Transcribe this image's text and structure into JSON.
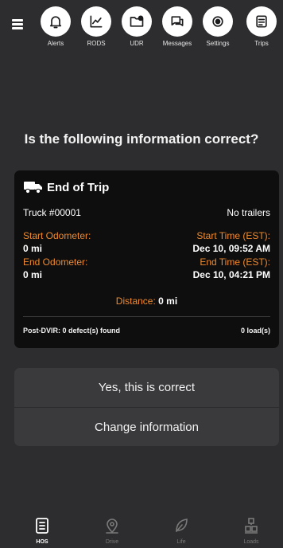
{
  "nav": {
    "items": [
      {
        "label": "Alerts",
        "icon": "bell-icon"
      },
      {
        "label": "RODS",
        "icon": "chart-icon"
      },
      {
        "label": "UDR",
        "icon": "folder-icon"
      },
      {
        "label": "Messages",
        "icon": "chat-icon"
      },
      {
        "label": "Settings",
        "icon": "gear-icon"
      },
      {
        "label": "Trips",
        "icon": "list-icon"
      }
    ]
  },
  "question": "Is the following information correct?",
  "card": {
    "title": "End of Trip",
    "truck": "Truck #00001",
    "trailers": "No trailers",
    "start_odometer_label": "Start Odometer:",
    "start_odometer_value": "0 mi",
    "start_time_label": "Start Time (EST):",
    "start_time_value": "Dec 10, 09:52 AM",
    "end_odometer_label": "End Odometer:",
    "end_odometer_value": "0 mi",
    "end_time_label": "End Time (EST):",
    "end_time_value": "Dec 10, 04:21 PM",
    "distance_label": "Distance:",
    "distance_value": "0 mi",
    "post_dvir": "Post-DVIR: 0  defect(s) found",
    "loads": "0 load(s)"
  },
  "actions": {
    "confirm": "Yes, this is correct",
    "change": "Change information"
  },
  "tabs": [
    {
      "label": "HOS",
      "active": true
    },
    {
      "label": "Drive",
      "active": false
    },
    {
      "label": "Life",
      "active": false
    },
    {
      "label": "Loads",
      "active": false
    }
  ],
  "colors": {
    "background": "#2d2d2f",
    "card": "#0e0e0e",
    "accent": "#f08a2e",
    "buttons": "#3a3a3c"
  }
}
